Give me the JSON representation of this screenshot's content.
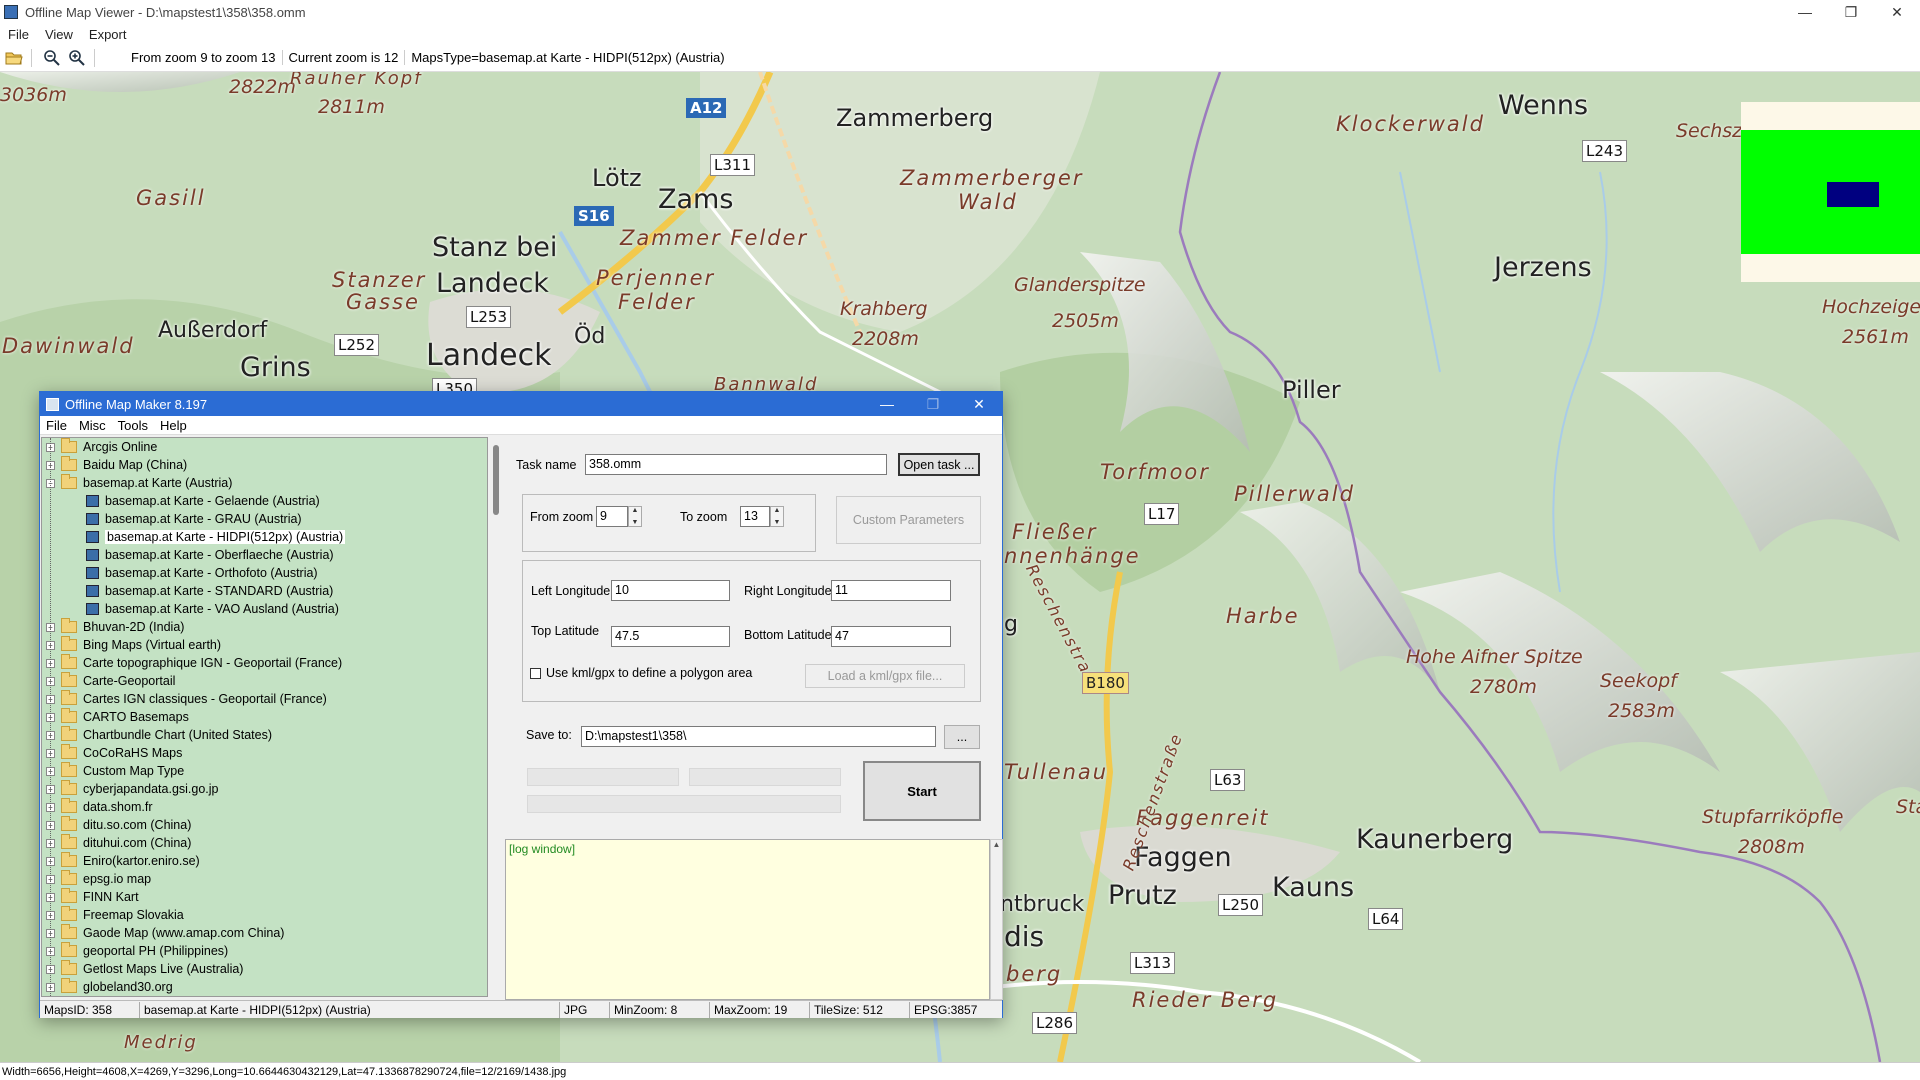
{
  "window": {
    "title": "Offline Map Viewer - D:\\mapstest1\\358\\358.omm",
    "minimize": "—",
    "maximize": "❐",
    "close": "✕"
  },
  "menu": [
    "File",
    "View",
    "Export"
  ],
  "toolbar": {
    "zoom_range": "From zoom 9 to zoom 13",
    "current_zoom": "Current zoom is 12",
    "maps_type": "MapsType=basemap.at Karte - HIDPI(512px) (Austria)"
  },
  "map": {
    "labels": {
      "l1": "3036m",
      "l2": "2822m",
      "l3": "Rauher Kopf",
      "l4": "2811m",
      "l5": "Gasill",
      "l6": "Lötz",
      "l7": "Zams",
      "l8": "Zammer Felder",
      "l9": "Stanz bei",
      "l10": "Landeck",
      "l11": "Stanzer",
      "l12": "Gasse",
      "l13": "Perjenner",
      "l14": "Felder",
      "l15": "Dawinwald",
      "l16": "Außerdorf",
      "l17": "Grins",
      "l18": "Landeck",
      "l19": "Öd",
      "l20": "Zammerberg",
      "l21": "Zammerberger",
      "l22": "Wald",
      "l23": "Krahberg",
      "l24": "2208m",
      "l25": "Glanderspitze",
      "l26": "2505m",
      "l27": "Klockerwald",
      "l28": "Wenns",
      "l29": "Sechsz",
      "l30": "Jerzens",
      "l31": "Hochzeiger",
      "l32": "2561m",
      "l33": "Piller",
      "l34": "Torfmoor",
      "l35": "Pillerwald",
      "l36": "Fließer",
      "l37": "nnenhänge",
      "l38": "Reschenstraße",
      "l39": "Harbe",
      "l40": "Hohe Aifner Spitze",
      "l41": "2780m",
      "l42": "Seekopf",
      "l43": "2583m",
      "l44": "Tullenau",
      "l45": "Faggenreit",
      "l46": "Faggen",
      "l47": "Kaunerberg",
      "l48": "Stupfarriköpfle",
      "l49": "2808m",
      "l50": "Kauns",
      "l51": "Prutz",
      "l52": "ntbruck",
      "l53": "dis",
      "l54": "berg",
      "l55": "Rieder Berg",
      "l56": "Medrig",
      "l57": "Bannwald",
      "l58": "Reschenstraße",
      "l59": "g",
      "l60": "Sta"
    },
    "roads": {
      "r1": "A12",
      "r2": "L311",
      "r3": "S16",
      "r4": "L253",
      "r5": "L252",
      "r6": "L350",
      "r7": "L243",
      "r8": "L17",
      "r9": "B180",
      "r10": "L63",
      "r11": "L250",
      "r12": "L64",
      "r13": "L313",
      "r14": "L286"
    }
  },
  "statusbar": "Width=6656,Height=4608,X=4269,Y=3296,Long=10.6644630432129,Lat=47.1336878290724,file=12/2169/1438.jpg",
  "dialog": {
    "title": "Offline Map Maker 8.197",
    "menu": [
      "File",
      "Misc",
      "Tools",
      "Help"
    ],
    "tree": {
      "items": [
        {
          "label": "Arcgis Online",
          "expanded": false
        },
        {
          "label": "Baidu Map (China)",
          "expanded": false
        },
        {
          "label": "basemap.at Karte (Austria)",
          "expanded": true
        },
        {
          "label": "basemap.at Karte - Gelaende (Austria)",
          "child": true
        },
        {
          "label": "basemap.at Karte - GRAU (Austria)",
          "child": true
        },
        {
          "label": "basemap.at Karte - HIDPI(512px) (Austria)",
          "child": true,
          "selected": true
        },
        {
          "label": "basemap.at Karte - Oberflaeche (Austria)",
          "child": true
        },
        {
          "label": "basemap.at Karte - Orthofoto (Austria)",
          "child": true
        },
        {
          "label": "basemap.at Karte - STANDARD (Austria)",
          "child": true
        },
        {
          "label": "basemap.at Karte - VAO Ausland (Austria)",
          "child": true
        },
        {
          "label": "Bhuvan-2D (India)",
          "expanded": false
        },
        {
          "label": "Bing Maps (Virtual earth)",
          "expanded": false
        },
        {
          "label": "Carte topographique IGN - Geoportail (France)",
          "expanded": false
        },
        {
          "label": "Carte-Geoportail",
          "expanded": false
        },
        {
          "label": "Cartes IGN classiques - Geoportail (France)",
          "expanded": false
        },
        {
          "label": "CARTO Basemaps",
          "expanded": false
        },
        {
          "label": "Chartbundle Chart (United States)",
          "expanded": false
        },
        {
          "label": "CoCoRaHS Maps",
          "expanded": false
        },
        {
          "label": "Custom Map Type",
          "expanded": false
        },
        {
          "label": "cyberjapandata.gsi.go.jp",
          "expanded": false
        },
        {
          "label": "data.shom.fr",
          "expanded": false
        },
        {
          "label": "ditu.so.com (China)",
          "expanded": false
        },
        {
          "label": "dituhui.com (China)",
          "expanded": false
        },
        {
          "label": "Eniro(kartor.eniro.se)",
          "expanded": false
        },
        {
          "label": "epsg.io map",
          "expanded": false
        },
        {
          "label": "FINN Kart",
          "expanded": false
        },
        {
          "label": "Freemap Slovakia",
          "expanded": false
        },
        {
          "label": "Gaode Map (www.amap.com China)",
          "expanded": false
        },
        {
          "label": "geoportal PH (Philippines)",
          "expanded": false
        },
        {
          "label": "Getlost Maps Live (Australia)",
          "expanded": false
        },
        {
          "label": "globeland30.org",
          "expanded": false
        }
      ]
    },
    "task_name_label": "Task name",
    "task_name_value": "358.omm",
    "open_task_label": "Open task ...",
    "from_zoom_label": "From zoom",
    "from_zoom_value": "9",
    "to_zoom_label": "To zoom",
    "to_zoom_value": "13",
    "custom_params_label": "Custom Parameters",
    "left_long_label": "Left Longitude",
    "left_long_value": "10",
    "right_long_label": "Right Longitude",
    "right_long_value": "11",
    "top_lat_label": "Top Latitude",
    "top_lat_value": "47.5",
    "bottom_lat_label": "Bottom Latitude",
    "bottom_lat_value": "47",
    "kml_checkbox_label": "Use kml/gpx to define a polygon area",
    "load_kml_label": "Load a kml/gpx file...",
    "save_to_label": "Save to:",
    "save_to_value": "D:\\mapstest1\\358\\",
    "browse_label": "...",
    "start_label": "Start",
    "log_text": "[log window]",
    "status": {
      "maps_id": "MapsID: 358",
      "maps_name": "basemap.at Karte - HIDPI(512px) (Austria)",
      "format": "JPG",
      "min_zoom": "MinZoom: 8",
      "max_zoom": "MaxZoom: 19",
      "tile_size": "TileSize: 512",
      "epsg": "EPSG:3857"
    }
  }
}
